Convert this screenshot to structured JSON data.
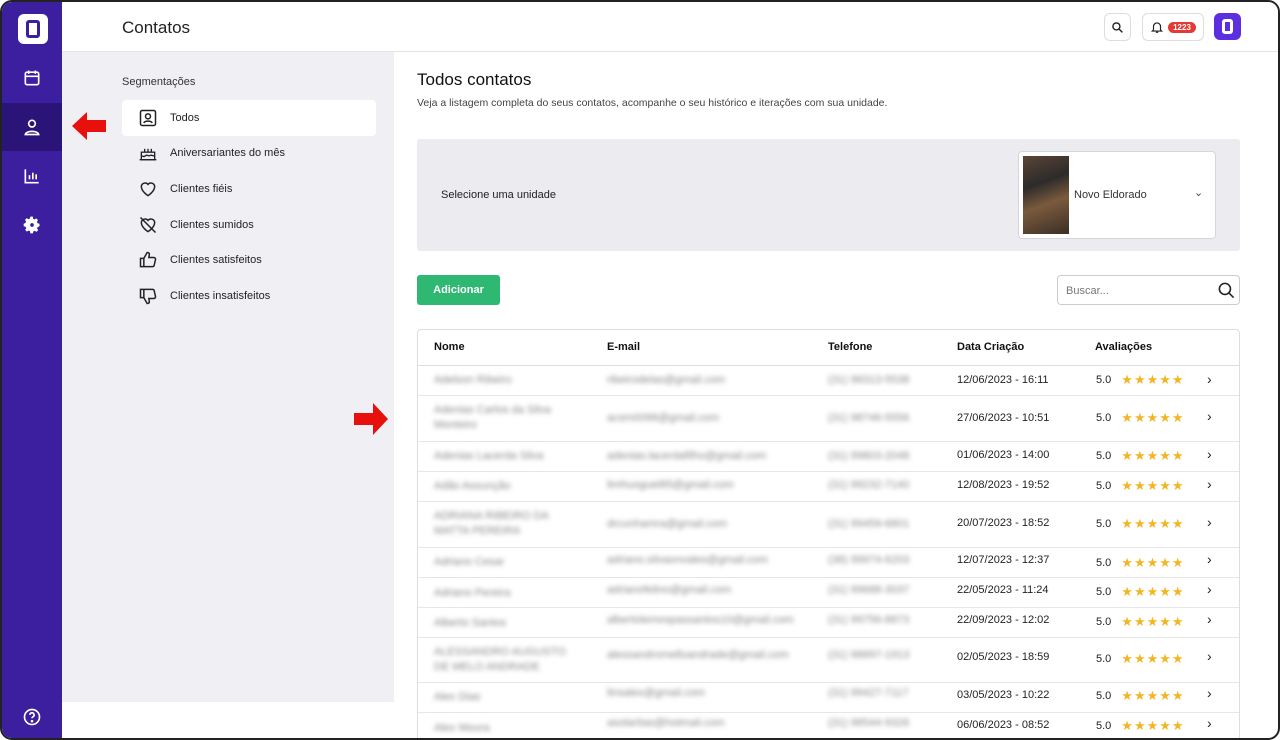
{
  "header": {
    "title": "Contatos",
    "notification_count": "1223"
  },
  "segments": {
    "title": "Segmentações",
    "items": [
      {
        "label": "Todos",
        "icon": "contact-card-icon"
      },
      {
        "label": "Aniversariantes do mês",
        "icon": "cake-icon"
      },
      {
        "label": "Clientes fiéis",
        "icon": "heart-icon"
      },
      {
        "label": "Clientes sumidos",
        "icon": "heart-off-icon"
      },
      {
        "label": "Clientes satisfeitos",
        "icon": "thumbs-up-icon"
      },
      {
        "label": "Clientes insatisfeitos",
        "icon": "thumbs-down-icon"
      }
    ]
  },
  "main": {
    "title": "Todos contatos",
    "subtitle": "Veja a listagem completa do seus contatos, acompanhe o seu histórico e iterações com sua unidade.",
    "unit_label": "Selecione uma unidade",
    "unit_selected": "Novo Eldorado",
    "add_label": "Adicionar",
    "search_placeholder": "Buscar..."
  },
  "table": {
    "columns": [
      "Nome",
      "E-mail",
      "Telefone",
      "Data Criação",
      "Avaliações"
    ],
    "rows": [
      {
        "name": "Adelson Ribeiro",
        "email": "ribeirodelas@gmail.com",
        "phone": "(31) 98313-5538",
        "date": "12/06/2023 - 16:11",
        "rating": "5.0"
      },
      {
        "name": "Adenias Carlos da Silva Monteiro",
        "email": "acsm0098@gmail.com",
        "phone": "(31) 98746-5556",
        "date": "27/06/2023 - 10:51",
        "rating": "5.0"
      },
      {
        "name": "Adenias Lacerda Silva",
        "email": "adenias.lacerdafilho@gmail.com",
        "phone": "(31) 99803-2048",
        "date": "01/06/2023 - 14:00",
        "rating": "5.0"
      },
      {
        "name": "Adão Assunção",
        "email": "limhuoguel85@gmail.com",
        "phone": "(31) 99232-7140",
        "date": "12/08/2023 - 19:52",
        "rating": "5.0"
      },
      {
        "name": "ADRIANA RIBEIRO DA MATTA PEREIRA",
        "email": "drcunhamra@gmail.com",
        "phone": "(31) 99459-6801",
        "date": "20/07/2023 - 18:52",
        "rating": "5.0"
      },
      {
        "name": "Adriano Cesar",
        "email": "adriano.silvaonvales@gmail.com",
        "phone": "(38) 99974-6203",
        "date": "12/07/2023 - 12:37",
        "rating": "5.0"
      },
      {
        "name": "Adriano Pereira",
        "email": "adrianofelino@gmail.com",
        "phone": "(31) 99688-3037",
        "date": "22/05/2023 - 11:24",
        "rating": "5.0"
      },
      {
        "name": "Alberto Santos",
        "email": "albertolemospassantos10@gmail.com",
        "phone": "(31) 99756-8873",
        "date": "22/09/2023 - 12:02",
        "rating": "5.0"
      },
      {
        "name": "ALESSANDRO AUGUSTO DE MELO ANDRADE",
        "email": "alessandromelloandrade@gmail.com",
        "phone": "(31) 98897-1913",
        "date": "02/05/2023 - 18:59",
        "rating": "5.0"
      },
      {
        "name": "Alex Dias",
        "email": "linsalex@gmail.com",
        "phone": "(31) 99427-7117",
        "date": "03/05/2023 - 10:22",
        "rating": "5.0"
      },
      {
        "name": "Alex Moura",
        "email": "asolaritas@hotmail.com",
        "phone": "(31) 98544-9326",
        "date": "06/06/2023 - 08:52",
        "rating": "5.0"
      }
    ]
  },
  "colors": {
    "sidebar": "#3b1f9e",
    "accent": "#2eb872",
    "star": "#f2b623",
    "badge": "#e53935",
    "annotation_arrow": "#e8100c"
  }
}
